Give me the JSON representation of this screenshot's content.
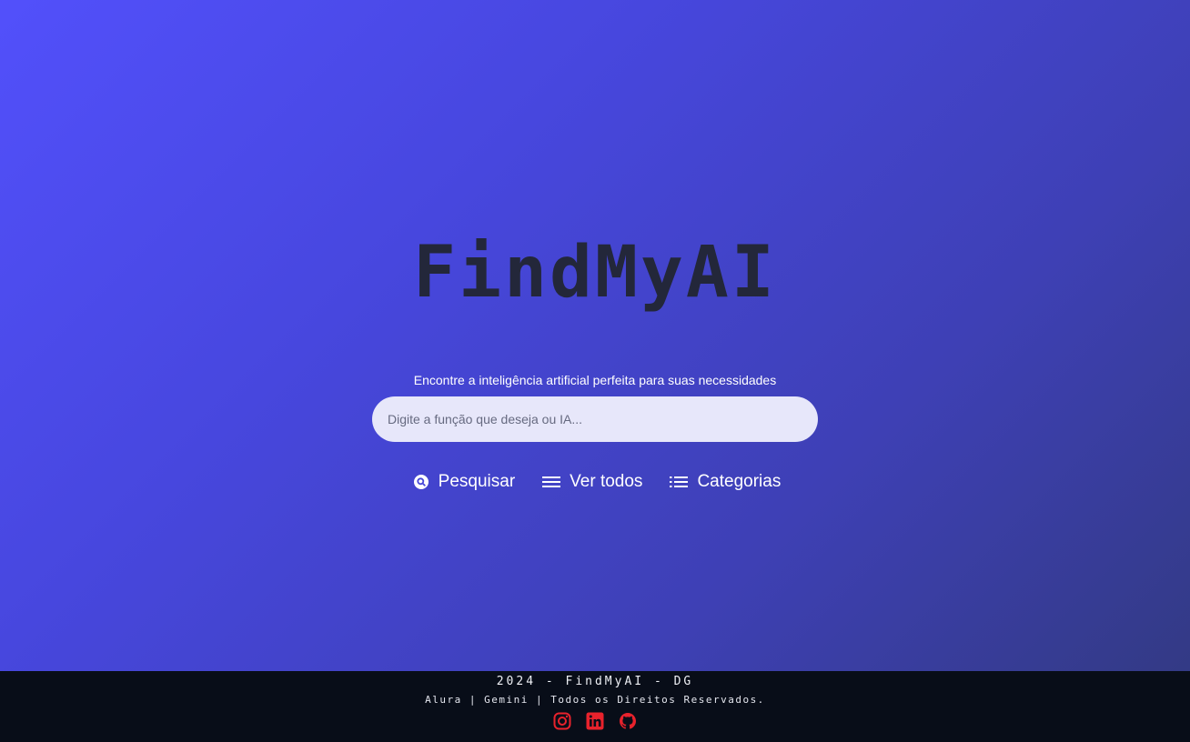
{
  "hero": {
    "logo": "FindMyAI",
    "tagline": "Encontre a inteligência artificial perfeita para suas necessidades",
    "search_placeholder": "Digite a função que deseja ou IA...",
    "search_value": ""
  },
  "actions": [
    {
      "label": "Pesquisar",
      "icon": "search-circle-icon"
    },
    {
      "label": "Ver todos",
      "icon": "hamburger-menu-icon"
    },
    {
      "label": "Categorias",
      "icon": "list-icon"
    }
  ],
  "footer": {
    "line1": "2024 - FindMyAI - DG",
    "line2": "Alura | Gemini | Todos os Direitos Reservados.",
    "socials": [
      {
        "icon": "instagram-icon"
      },
      {
        "icon": "linkedin-icon"
      },
      {
        "icon": "github-icon"
      }
    ]
  },
  "colors": {
    "gradient_start": "#5250fb",
    "gradient_end": "#333a85",
    "logo_text": "#23273a",
    "search_bg": "#e7e7fa",
    "footer_bg": "#080d18",
    "social_icon": "#e8222c"
  }
}
